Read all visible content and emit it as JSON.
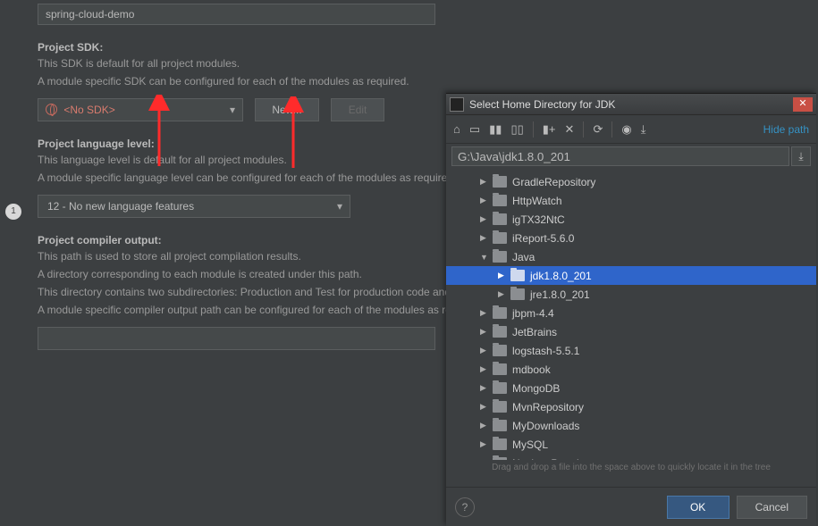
{
  "badge": "1",
  "project_name": "spring-cloud-demo",
  "sdk": {
    "title": "Project SDK:",
    "desc1": "This SDK is default for all project modules.",
    "desc2": "A module specific SDK can be configured for each of the modules as required.",
    "selected": "<No SDK>",
    "new_btn": "New...",
    "edit_btn": "Edit"
  },
  "lang": {
    "title": "Project language level:",
    "desc1": "This language level is default for all project modules.",
    "desc2": "A module specific language level can be configured for each of the modules as required.",
    "selected": "12 - No new language features"
  },
  "output": {
    "title": "Project compiler output:",
    "desc1": "This path is used to store all project compilation results.",
    "desc2": "A directory corresponding to each module is created under this path.",
    "desc3": "This directory contains two subdirectories: Production and Test for production code and test sources, respectively.",
    "desc4": "A module specific compiler output path can be configured for each of the modules as required."
  },
  "dialog": {
    "title": "Select Home Directory for JDK",
    "hide_path": "Hide path",
    "path": "G:\\Java\\jdk1.8.0_201",
    "drag_hint": "Drag and drop a file into the space above to quickly locate it in the tree",
    "ok": "OK",
    "cancel": "Cancel",
    "tree": [
      {
        "label": "GradleRepository",
        "depth": 1,
        "exp": "▶"
      },
      {
        "label": "HttpWatch",
        "depth": 1,
        "exp": "▶"
      },
      {
        "label": "igTX32NtC",
        "depth": 1,
        "exp": "▶"
      },
      {
        "label": "iReport-5.6.0",
        "depth": 1,
        "exp": "▶"
      },
      {
        "label": "Java",
        "depth": 1,
        "exp": "▼"
      },
      {
        "label": "jdk1.8.0_201",
        "depth": 2,
        "exp": "▶",
        "selected": true
      },
      {
        "label": "jre1.8.0_201",
        "depth": 2,
        "exp": "▶"
      },
      {
        "label": "jbpm-4.4",
        "depth": 1,
        "exp": "▶"
      },
      {
        "label": "JetBrains",
        "depth": 1,
        "exp": "▶"
      },
      {
        "label": "logstash-5.5.1",
        "depth": 1,
        "exp": "▶"
      },
      {
        "label": "mdbook",
        "depth": 1,
        "exp": "▶"
      },
      {
        "label": "MongoDB",
        "depth": 1,
        "exp": "▶"
      },
      {
        "label": "MvnRepository",
        "depth": 1,
        "exp": "▶"
      },
      {
        "label": "MyDownloads",
        "depth": 1,
        "exp": "▶"
      },
      {
        "label": "MySQL",
        "depth": 1,
        "exp": "▶"
      },
      {
        "label": "Navicat Premium",
        "depth": 1,
        "exp": "▶"
      }
    ]
  }
}
